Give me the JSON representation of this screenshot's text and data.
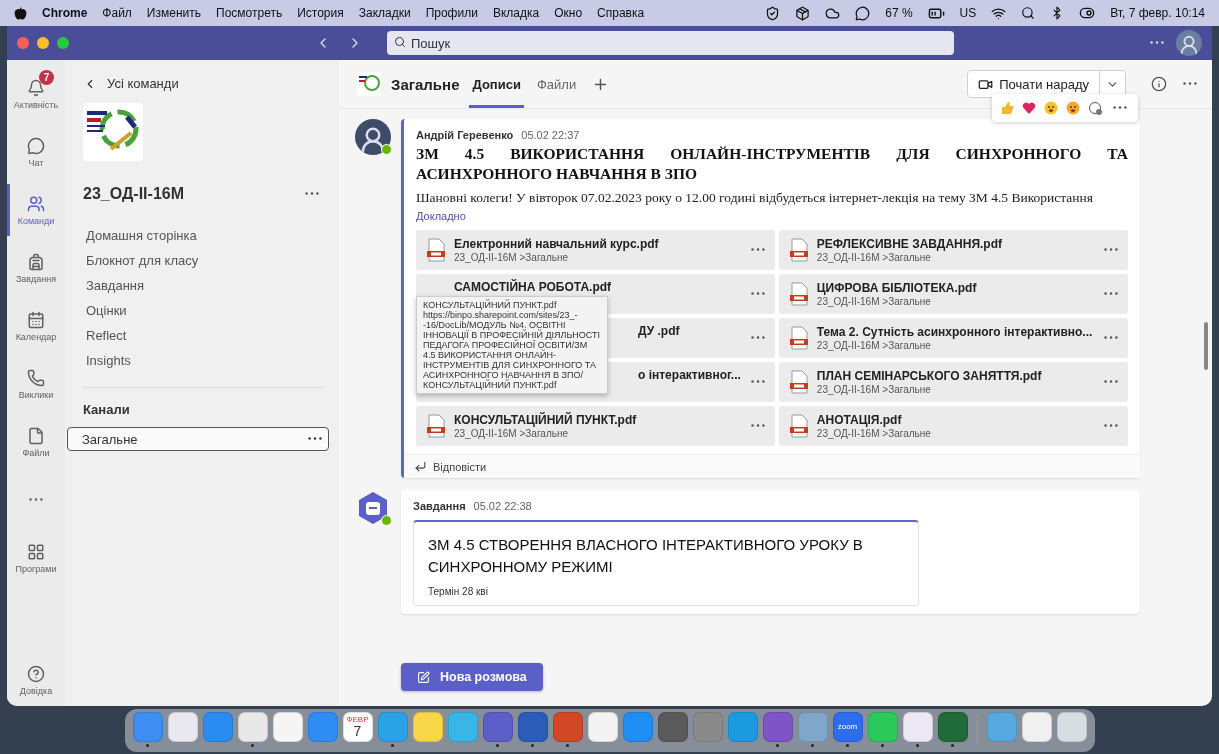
{
  "menubar": {
    "app": "Chrome",
    "menus": [
      "Файл",
      "Изменить",
      "Посмотреть",
      "История",
      "Закладки",
      "Профили",
      "Вкладка",
      "Окно",
      "Справка"
    ],
    "battery": "67 %",
    "input_source": "US",
    "clock": "Вт, 7 февр. 10:14"
  },
  "titlebar": {
    "search": {
      "placeholder": "Пошук"
    }
  },
  "rail": {
    "items": [
      {
        "kind": "activity",
        "label": "Активність",
        "badge": "7",
        "selected": false
      },
      {
        "kind": "chat",
        "label": "Чат",
        "selected": false
      },
      {
        "kind": "teams",
        "label": "Команди",
        "selected": true
      },
      {
        "kind": "assignments",
        "label": "Завдання",
        "selected": false
      },
      {
        "kind": "calendar",
        "label": "Календар",
        "selected": false
      },
      {
        "kind": "calls",
        "label": "Виклики",
        "selected": false
      },
      {
        "kind": "files",
        "label": "Файли",
        "selected": false
      },
      {
        "kind": "more",
        "selected": false
      },
      {
        "kind": "apps",
        "label": "Програми",
        "selected": false
      }
    ],
    "help": "Довідка"
  },
  "panel": {
    "back": "Усі команди",
    "team_name": "23_ОД-ІІ-16М",
    "nav": [
      "Домашня сторінка",
      "Блокнот для класу",
      "Завдання",
      "Оцінки",
      "Reflect",
      "Insights"
    ],
    "channels_heading": "Канали",
    "channels": [
      {
        "name": "Загальне",
        "selected": true
      }
    ]
  },
  "channel_header": {
    "name": "Загальне",
    "tabs": [
      {
        "label": "Дописи",
        "selected": true
      },
      {
        "label": "Файли",
        "selected": false
      }
    ],
    "meet_button": "Почати нараду"
  },
  "posts": [
    {
      "kind": "announcement",
      "author": "Андрій Геревенко",
      "online": true,
      "time": "05.02 22:37",
      "title": "ЗМ 4.5 ВИКОРИСТАННЯ ОНЛАЙН-ІНСТРУМЕНТІВ ДЛЯ СИНХРОННОГО ТА АСИНХРОННОГО НАВЧАННЯ В ЗПО",
      "body": "Шановні колеги! У вівторок 07.02.2023 року о 12.00 годині відбудеться інтернет-лекція на тему  ЗМ 4.5 Використання",
      "more_link": "Докладно",
      "files": [
        {
          "name": "Електронний навчальний курс.pdf",
          "location": "23_ОД-ІІ-16М >Загальне",
          "covered": false
        },
        {
          "name": "РЕФЛЕКСИВНЕ ЗАВДАННЯ.pdf",
          "location": "23_ОД-ІІ-16М >Загальне",
          "covered": false
        },
        {
          "name": "САМОСТІЙНА РОБОТА.pdf",
          "covered": false
        },
        {
          "name": "ЦИФРОВА БІБЛІОТЕКА.pdf",
          "location": "23_ОД-ІІ-16М >Загальне",
          "covered": false
        },
        {
          "name": "ДУ .pdf",
          "covered": true
        },
        {
          "name": "Тема 2. Сутність асинхронного інтерактивно...",
          "location": "23_ОД-ІІ-16М >Загальне",
          "covered": false
        },
        {
          "name": "о інтерактивног...",
          "covered": true
        },
        {
          "name": "ПЛАН СЕМІНАРСЬКОГО ЗАНЯТТЯ.pdf",
          "location": "23_ОД-ІІ-16М >Загальне",
          "covered": false
        },
        {
          "name": "КОНСУЛЬТАЦІЙНИЙ ПУНКТ.pdf",
          "location": "23_ОД-ІІ-16М >Загальне",
          "covered": false
        },
        {
          "name": "АНОТАЦІЯ.pdf",
          "location": "23_ОД-ІІ-16М >Загальне",
          "covered": false
        }
      ],
      "tooltip": {
        "title": "КОНСУЛЬТАЦІЙНИЙ ПУНКТ.pdf",
        "path": "https://binpo.sharepoint.com/sites/23_--16/DocLib/МОДУЛЬ №4. ОСВІТНІ ІННОВАЦІЇ В ПРОФЕСІЙНІЙ ДІЯЛЬНОСТІ ПЕДАГОГА ПРОФЕСІЙНОЇ ОСВІТИ/ЗМ 4.5 ВИКОРИСТАННЯ ОНЛАЙН-ІНСТРУМЕНТІВ ДЛЯ СИНХРОННОГО ТА АСИНХРОННОГО НАВЧАННЯ В ЗПО/КОНСУЛЬТАЦІЙНИЙ ПУНКТ.pdf"
      },
      "reply": "Відповісти"
    },
    {
      "kind": "assignment",
      "author": "Завдання",
      "online": true,
      "time": "05.02 22:38",
      "card": {
        "title": "ЗМ 4.5 СТВОРЕННЯ ВЛАСНОГО ІНТЕРАКТИВНОГО УРОКУ В СИНХРОННОМУ РЕЖИМІ",
        "due": "Термін 28 кві"
      }
    }
  ],
  "new_conversation": "Нова розмова",
  "dock": [
    {
      "color": "#3d8ef0",
      "running": true
    },
    {
      "color": "#e8e8ee",
      "running": false
    },
    {
      "color": "#2a8cf0",
      "running": false
    },
    {
      "color": "#e8e8e8",
      "running": true
    },
    {
      "color": "#f5f5f5",
      "running": false
    },
    {
      "color": "#2f8cf5",
      "running": false
    },
    {
      "color": "#ffffff",
      "running": false,
      "caption": "ФЕВР",
      "label": "7"
    },
    {
      "color": "#2aa3e6",
      "running": true
    },
    {
      "color": "#f7d64a",
      "running": false
    },
    {
      "color": "#38b6e8",
      "running": false
    },
    {
      "color": "#5b5fc7",
      "running": true
    },
    {
      "color": "#2b5cb8",
      "running": true
    },
    {
      "color": "#d24726",
      "running": true
    },
    {
      "color": "#f3f3f3",
      "running": false
    },
    {
      "color": "#1e8ef5",
      "running": false
    },
    {
      "color": "#5a5a5a",
      "running": false
    },
    {
      "color": "#8a8a8a",
      "running": false
    },
    {
      "color": "#1a9be0",
      "running": false
    },
    {
      "color": "#7d55c7",
      "running": true
    },
    {
      "color": "#7fa7c9",
      "running": true
    },
    {
      "color": "#2d6cf0",
      "running": true,
      "label": "zoom"
    },
    {
      "color": "#2bc85a",
      "running": true
    },
    {
      "color": "#ece8f5",
      "running": true
    },
    {
      "color": "#1f6b3a",
      "running": true
    },
    {
      "color": "#58a8e0",
      "running": false
    },
    {
      "color": "#f0f0f0",
      "running": false
    },
    {
      "color": "#d8dde2",
      "running": false
    }
  ]
}
